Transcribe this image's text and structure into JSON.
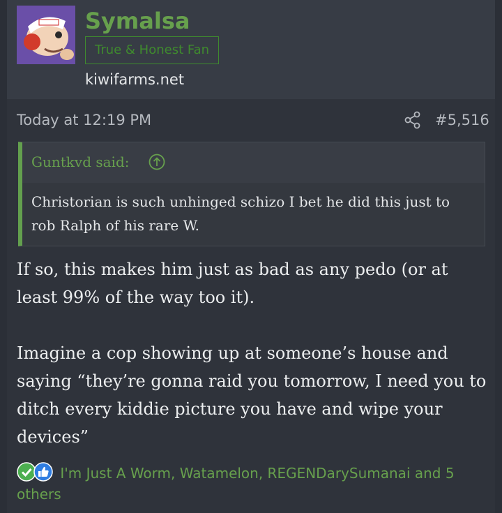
{
  "user": {
    "name": "Symalsa",
    "title": "True & Honest Fan",
    "site": "kiwifarms.net"
  },
  "post": {
    "date": "Today at 12:19 PM",
    "number": "#5,516",
    "quote": {
      "author": "Guntkvd said:",
      "text": "Christorian is such unhinged schizo I bet he did this just to rob Ralph of his rare W."
    },
    "paragraphs": [
      "If so, this makes him just as bad as any pedo (or at least 99% of the way too it).",
      "Imagine a cop showing up at someone’s house and saying “they’re gonna raid you tomorrow, I need you to ditch every kiddie picture you have and wipe your devices”"
    ],
    "reactions": {
      "icons": [
        "check-reaction-icon",
        "like-reaction-icon"
      ],
      "text": "I'm Just A Worm, Watamelon, REGENDarySumanai and 5 others"
    }
  },
  "colors": {
    "accent": "#67a04d",
    "background": "#2f333b",
    "text": "#eceeef"
  }
}
